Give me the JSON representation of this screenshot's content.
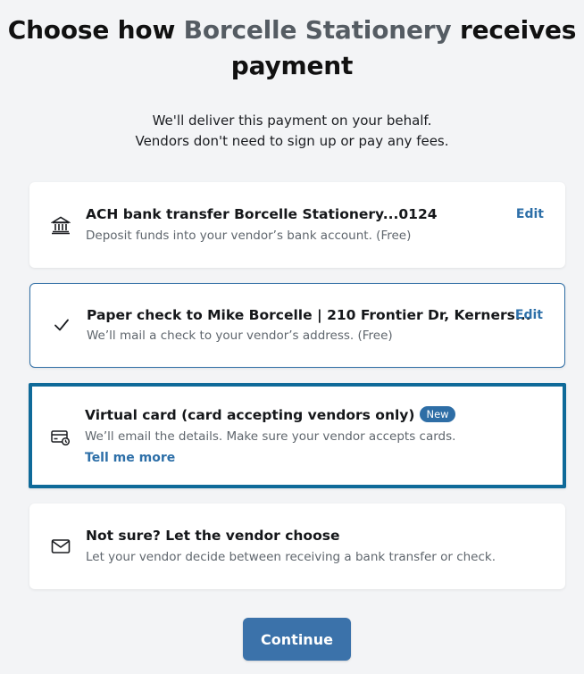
{
  "header": {
    "title_prefix": "Choose how ",
    "vendor_name": "Borcelle Stationery",
    "title_suffix": " receives payment",
    "subtitle_line1": "We'll deliver this payment on your behalf.",
    "subtitle_line2": "Vendors don't need to sign up or pay any fees."
  },
  "options": [
    {
      "icon": "bank-icon",
      "title": "ACH bank transfer Borcelle Stationery...0124",
      "description": "Deposit funds into your vendor’s bank account. (Free)",
      "action": "Edit"
    },
    {
      "icon": "checkmark-icon",
      "title": "Paper check to Mike Borcelle | 210 Frontier Dr, Kerners...",
      "description": "We’ll mail a check to your vendor’s address. (Free)",
      "action": "Edit",
      "selected": true
    },
    {
      "icon": "virtual-card-icon",
      "title": "Virtual card (card accepting vendors only)",
      "badge": "New",
      "description": "We’ll email the details. Make sure your vendor accepts cards.",
      "link": "Tell me more"
    },
    {
      "icon": "envelope-icon",
      "title": "Not sure? Let the vendor choose",
      "description": "Let your vendor decide between receiving a bank transfer or check."
    }
  ],
  "footer": {
    "continue_label": "Continue"
  },
  "colors": {
    "accent": "#2d6fa8",
    "button": "#3b72aa",
    "highlight_border": "#0f6a99",
    "background": "#f3f4f6"
  }
}
